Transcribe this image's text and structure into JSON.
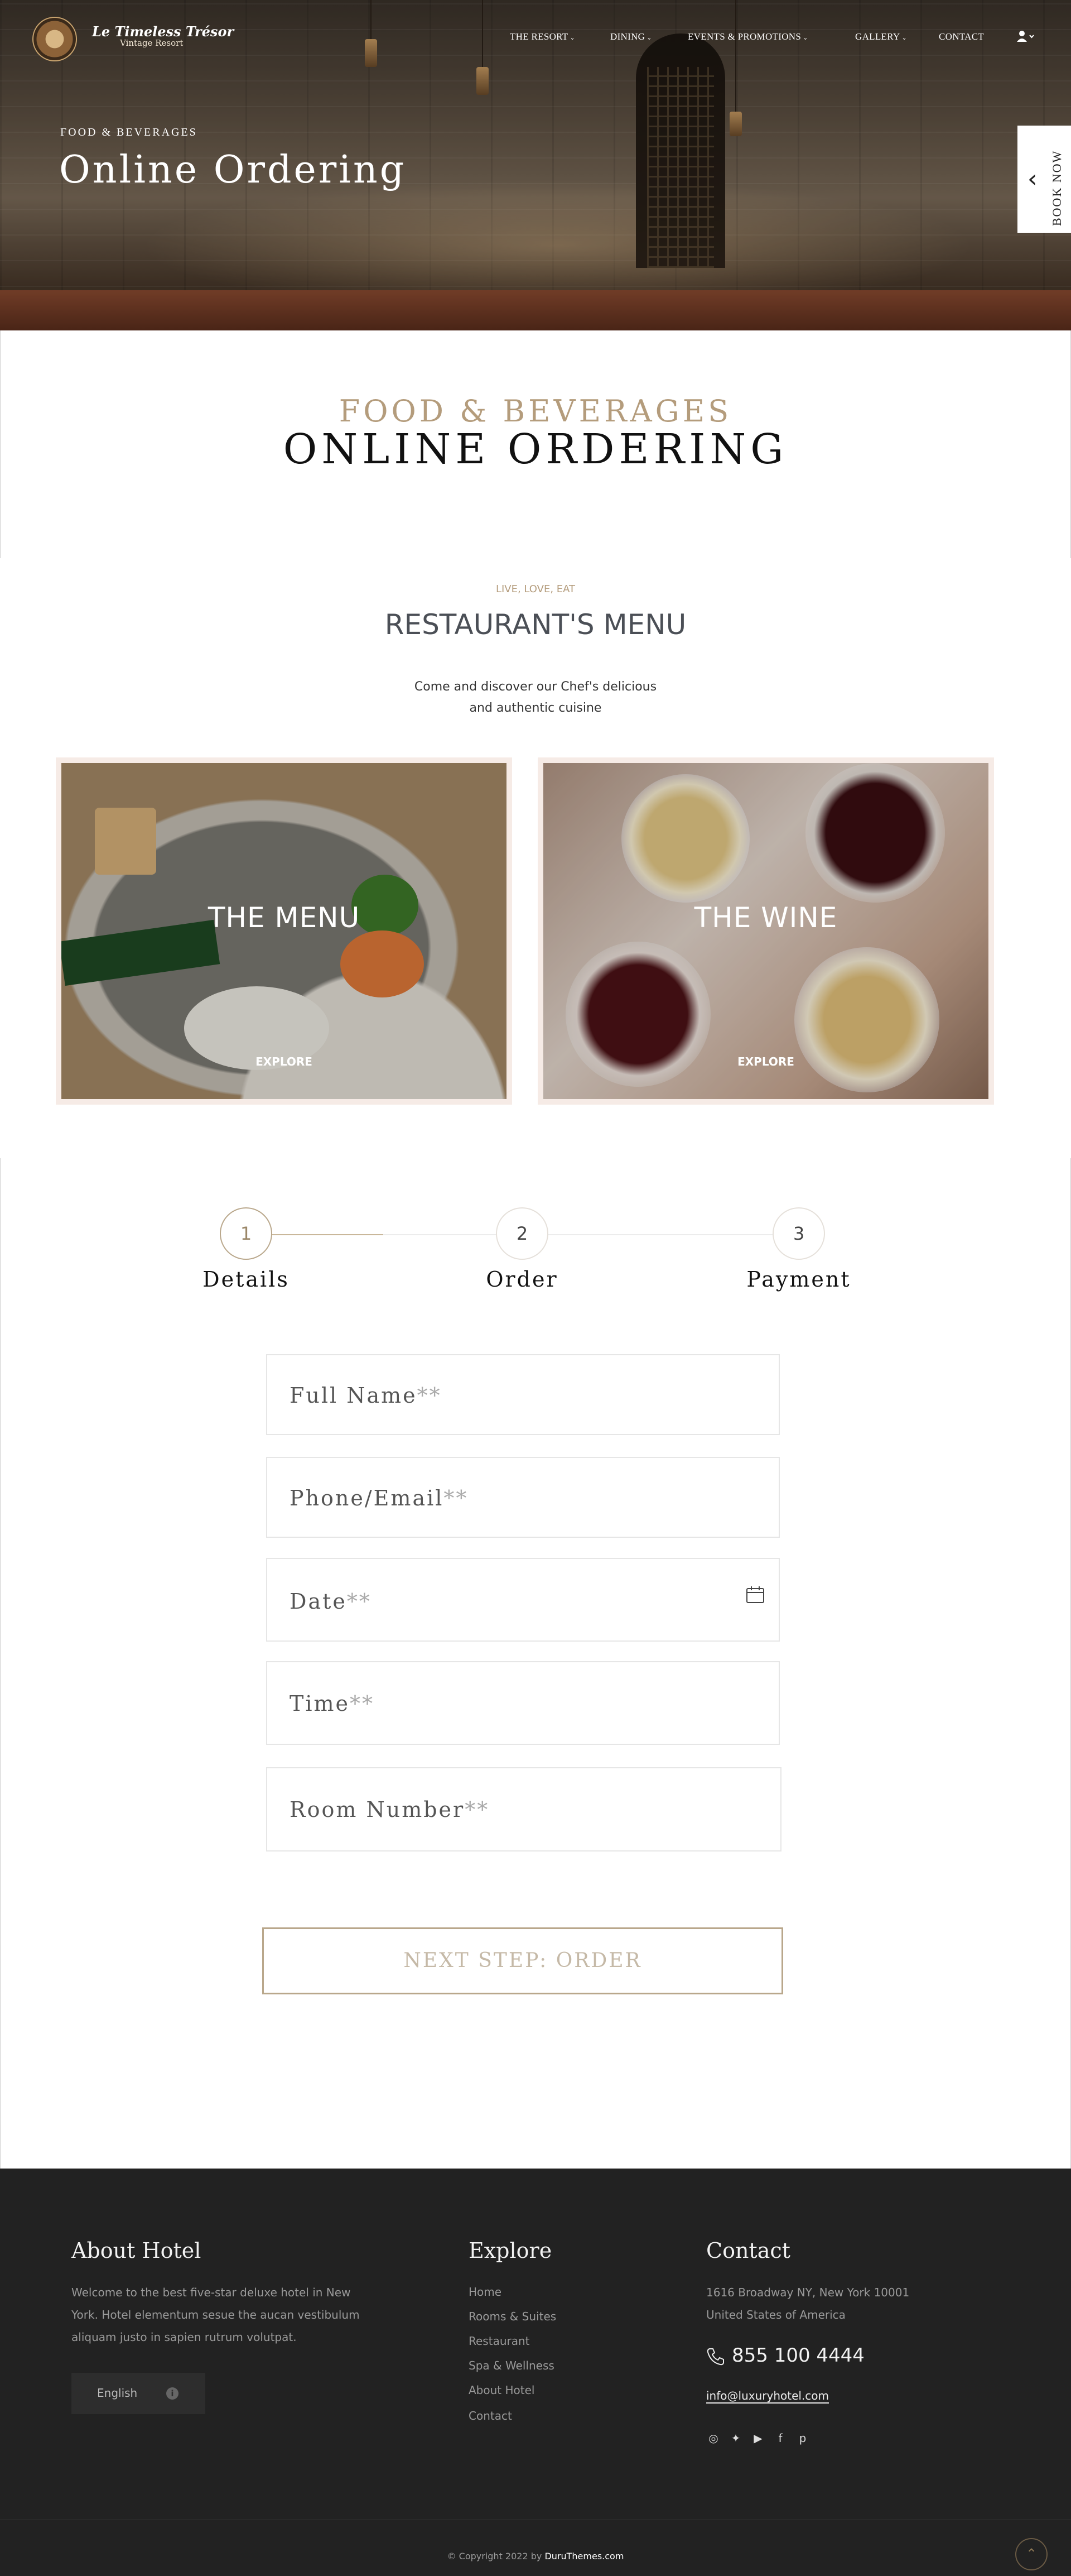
{
  "header": {
    "brand_name": "Le Timeless Trésor",
    "brand_sub": "Vintage Resort",
    "nav": [
      {
        "label": "THE RESORT",
        "has_dropdown": true
      },
      {
        "label": "DINING",
        "has_dropdown": true
      },
      {
        "label": "EVENTS & PROMOTIONS",
        "has_dropdown": true
      },
      {
        "label": "GALLERY",
        "has_dropdown": true
      },
      {
        "label": "CONTACT",
        "has_dropdown": false
      }
    ],
    "chevron": "⌄"
  },
  "hero": {
    "kicker": "FOOD & BEVERAGES",
    "title": "Online Ordering"
  },
  "book_now": {
    "label": "BOOK NOW",
    "arrow": "‹"
  },
  "page_title": {
    "kicker": "FOOD & BEVERAGES",
    "title": "ONLINE ORDERING"
  },
  "menu_section": {
    "eyebrow": "LIVE, LOVE, EAT",
    "title": "RESTAURANT'S MENU",
    "desc_line1": "Come and discover our Chef's delicious",
    "desc_line2": "and authentic cuisine",
    "cards": [
      {
        "title": "THE MENU",
        "cta": "EXPLORE"
      },
      {
        "title": "THE WINE",
        "cta": "EXPLORE"
      }
    ]
  },
  "steps": [
    {
      "number": "1",
      "label": "Details",
      "active": true
    },
    {
      "number": "2",
      "label": "Order",
      "active": false
    },
    {
      "number": "3",
      "label": "Payment",
      "active": false
    }
  ],
  "form": {
    "fields": [
      {
        "placeholder": "Full Name",
        "required_mark": "**"
      },
      {
        "placeholder": "Phone/Email",
        "required_mark": "**"
      },
      {
        "placeholder": "Date",
        "required_mark": "**"
      },
      {
        "placeholder": "Time",
        "required_mark": "**"
      },
      {
        "placeholder": "Room Number",
        "required_mark": "**"
      }
    ],
    "next_button": "NEXT STEP: ORDER"
  },
  "footer": {
    "about_title": "About Hotel",
    "about_line1": "Welcome to the best five-star deluxe hotel in New",
    "about_line2": "York. Hotel elementum sesue the aucan vestibulum",
    "about_line3": "aliquam justo in sapien rutrum volutpat.",
    "language": "English",
    "explore_title": "Explore",
    "explore_links": [
      "Home",
      "Rooms & Suites",
      "Restaurant",
      "Spa & Wellness",
      "About Hotel",
      "Contact"
    ],
    "contact_title": "Contact",
    "address_line1": "1616 Broadway NY, New York 10001",
    "address_line2": "United States of America",
    "phone": "855 100 4444",
    "email": "info@luxuryhotel.com",
    "social_icons": [
      "instagram-icon",
      "twitter-icon",
      "youtube-icon",
      "facebook-icon",
      "pinterest-icon"
    ],
    "copyright_prefix": "© Copyright 2022 by ",
    "copyright_brand": "DuruThemes.com"
  },
  "colors": {
    "accent_gold": "#b49c7c",
    "footer_bg": "#222222",
    "border_light": "#e6e6e6"
  }
}
